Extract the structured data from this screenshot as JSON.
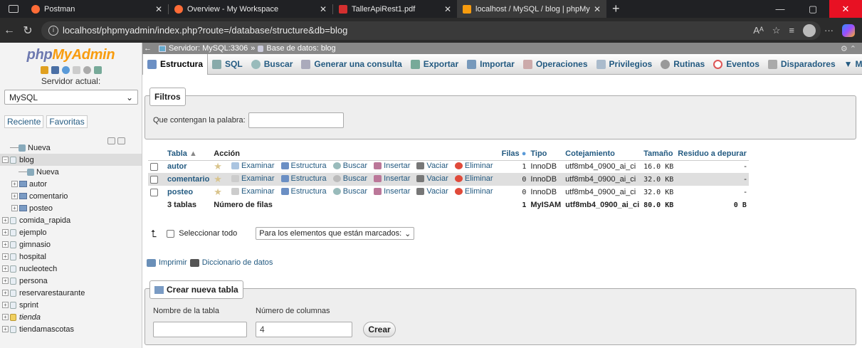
{
  "browser": {
    "tabs": [
      {
        "title": "Postman",
        "color": "#ff6c37"
      },
      {
        "title": "Overview - My Workspace",
        "color": "#ff6c37"
      },
      {
        "title": "TallerApiRest1.pdf",
        "color": "#d32f2f"
      },
      {
        "title": "localhost / MySQL / blog | phpMy",
        "color": "#f89c0e"
      }
    ],
    "new_tab": "+",
    "url": "localhost/phpmyadmin/index.php?route=/database/structure&db=blog",
    "window_controls": {
      "minimize": "—",
      "maximize": "▢",
      "close": "✕"
    }
  },
  "sidebar": {
    "logo_php": "php",
    "logo_my": "MyAdmin",
    "server_label": "Servidor actual:",
    "server_value": "MySQL",
    "links": [
      "Reciente",
      "Favoritas"
    ],
    "tree": [
      {
        "label": "Nueva",
        "type": "new",
        "level": 0
      },
      {
        "label": "blog",
        "type": "db",
        "level": 0,
        "selected": true
      },
      {
        "label": "Nueva",
        "type": "new",
        "level": 1
      },
      {
        "label": "autor",
        "type": "table",
        "level": 1
      },
      {
        "label": "comentario",
        "type": "table",
        "level": 1
      },
      {
        "label": "posteo",
        "type": "table",
        "level": 1
      },
      {
        "label": "comida_rapida",
        "type": "db",
        "level": 0
      },
      {
        "label": "ejemplo",
        "type": "db",
        "level": 0
      },
      {
        "label": "gimnasio",
        "type": "db",
        "level": 0
      },
      {
        "label": "hospital",
        "type": "db",
        "level": 0
      },
      {
        "label": "nucleotech",
        "type": "db",
        "level": 0
      },
      {
        "label": "persona",
        "type": "db",
        "level": 0
      },
      {
        "label": "reservarestaurante",
        "type": "db",
        "level": 0
      },
      {
        "label": "sprint",
        "type": "db",
        "level": 0
      },
      {
        "label": "tienda",
        "type": "db-italic",
        "level": 0
      },
      {
        "label": "tiendamascotas",
        "type": "db",
        "level": 0
      }
    ]
  },
  "breadcrumb": {
    "server": "Servidor: MySQL:3306",
    "sep": "»",
    "database": "Base de datos: blog"
  },
  "menu": [
    {
      "label": "Estructura",
      "active": true,
      "color": "#6b8fc4"
    },
    {
      "label": "SQL",
      "color": "#8aa"
    },
    {
      "label": "Buscar",
      "color": "#9bb"
    },
    {
      "label": "Generar una consulta",
      "color": "#aab"
    },
    {
      "label": "Exportar",
      "color": "#7a9"
    },
    {
      "label": "Importar",
      "color": "#79b"
    },
    {
      "label": "Operaciones",
      "color": "#caa"
    },
    {
      "label": "Privilegios",
      "color": "#abc"
    },
    {
      "label": "Rutinas",
      "color": "#999"
    },
    {
      "label": "Eventos",
      "color": "#d55"
    },
    {
      "label": "Disparadores",
      "color": "#aaa"
    },
    {
      "label": "Má",
      "color": "#888"
    }
  ],
  "filters": {
    "legend": "Filtros",
    "label": "Que contengan la palabra:",
    "value": ""
  },
  "table": {
    "headers": [
      "Tabla",
      "Acción",
      "Filas",
      "Tipo",
      "Cotejamiento",
      "Tamaño",
      "Residuo a depurar"
    ],
    "actions": [
      "Examinar",
      "Estructura",
      "Buscar",
      "Insertar",
      "Vaciar",
      "Eliminar"
    ],
    "rows": [
      {
        "name": "autor",
        "rows": "1",
        "type": "InnoDB",
        "collation": "utf8mb4_0900_ai_ci",
        "size": "16.0 KB",
        "overhead": "-"
      },
      {
        "name": "comentario",
        "rows": "0",
        "type": "InnoDB",
        "collation": "utf8mb4_0900_ai_ci",
        "size": "32.0 KB",
        "overhead": "-"
      },
      {
        "name": "posteo",
        "rows": "0",
        "type": "InnoDB",
        "collation": "utf8mb4_0900_ai_ci",
        "size": "32.0 KB",
        "overhead": "-"
      }
    ],
    "footer": {
      "name": "3 tablas",
      "action": "Número de filas",
      "rows": "1",
      "type": "MyISAM",
      "collation": "utf8mb4_0900_ai_ci",
      "size": "80.0 KB",
      "overhead": "0 B"
    }
  },
  "with_selected": {
    "select_all": "Seleccionar todo",
    "dropdown": "Para los elementos que están marcados:"
  },
  "links": {
    "print": "Imprimir",
    "dictionary": "Diccionario de datos"
  },
  "create_table": {
    "legend": "Crear nueva tabla",
    "name_label": "Nombre de la tabla",
    "cols_label": "Número de columnas",
    "name_value": "",
    "cols_value": "4",
    "button": "Crear"
  }
}
